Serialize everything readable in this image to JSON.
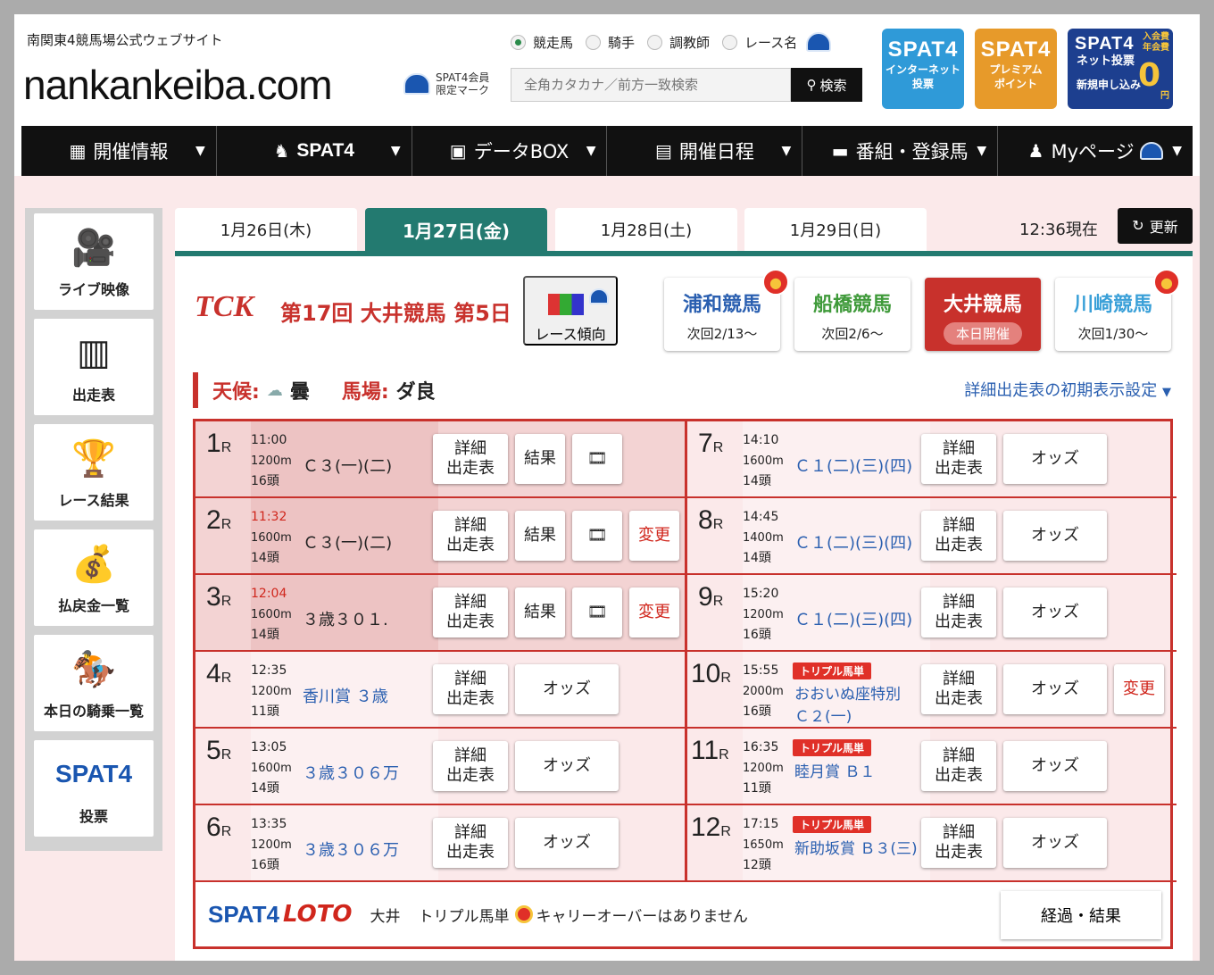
{
  "header": {
    "tagline": "南関東4競馬場公式ウェブサイト",
    "logo": "nankankeiba.com",
    "member_mark": "SPAT4会員\n限定マーク",
    "member_mark_l1": "SPAT4会員",
    "member_mark_l2": "限定マーク",
    "search_modes": [
      {
        "label": "競走馬",
        "selected": true
      },
      {
        "label": "騎手",
        "selected": false
      },
      {
        "label": "調教師",
        "selected": false
      },
      {
        "label": "レース名",
        "selected": false
      }
    ],
    "search_placeholder": "全角カタカナ／前方一致検索",
    "search_button": "検索",
    "buttons": [
      {
        "title": "SPAT4",
        "sub1": "インターネット",
        "sub2": "投票",
        "color": "#2f9ad8"
      },
      {
        "title": "SPAT4",
        "sub1": "プレミアム",
        "sub2": "ポイント",
        "color": "#e79a2a"
      },
      {
        "title": "SPAT4",
        "sub1": "ネット投票",
        "sub2": "新規申し込み",
        "tag1": "入会費",
        "tag2": "年会費",
        "zero": "0",
        "yen": "円",
        "color": "#1d3f8f"
      }
    ]
  },
  "nav": [
    {
      "label": "開催情報",
      "icon": "calendar-grid-icon"
    },
    {
      "label": "SPAT4",
      "icon": "horse-icon"
    },
    {
      "label": "データBOX",
      "icon": "chart-box-icon"
    },
    {
      "label": "開催日程",
      "icon": "calendar-icon"
    },
    {
      "label": "番組・登録馬",
      "icon": "list-icon"
    },
    {
      "label": "Myページ",
      "icon": "person-icon"
    }
  ],
  "sidebar": [
    {
      "label": "ライブ映像",
      "icon": "video-camera-icon"
    },
    {
      "label": "出走表",
      "icon": "entry-table-icon"
    },
    {
      "label": "レース結果",
      "icon": "podium-icon"
    },
    {
      "label": "払戻金一覧",
      "icon": "coins-icon"
    },
    {
      "label": "本日の騎乗一覧",
      "icon": "jockey-icon"
    },
    {
      "label": "SPAT4",
      "sub": "投票",
      "icon": "spat4-logo-icon"
    }
  ],
  "date_tabs": [
    {
      "label": "1月26日(木)",
      "active": false
    },
    {
      "label": "1月27日(金)",
      "active": true
    },
    {
      "label": "1月28日(土)",
      "active": false
    },
    {
      "label": "1月29日(日)",
      "active": false
    }
  ],
  "status": {
    "time": "12:36現在",
    "refresh": "更新"
  },
  "meeting": {
    "logo": "TCK",
    "title": "第17回 大井競馬 第5日",
    "trend": "レース傾向"
  },
  "venues": [
    {
      "name": "浦和競馬",
      "sub": "次回2/13〜",
      "color": "#2a5fb0",
      "coin": true
    },
    {
      "name": "船橋競馬",
      "sub": "次回2/6〜",
      "color": "#3f9a3a",
      "coin": false
    },
    {
      "name": "大井競馬",
      "sub": "本日開催",
      "active": true
    },
    {
      "name": "川崎競馬",
      "sub": "次回1/30〜",
      "color": "#3aa0d8",
      "coin": true
    }
  ],
  "conditions": {
    "weather_label": "天候:",
    "weather": "曇",
    "track_label": "馬場:",
    "track": "ダ良",
    "setting_link": "詳細出走表の初期表示設定"
  },
  "races": [
    {
      "no": "1",
      "time": "11:00",
      "dist": "1200m",
      "heads": "16頭",
      "name": "Ｃ３(一)(二)",
      "link": false,
      "done": true,
      "buttons": [
        "detail",
        "result",
        "video"
      ]
    },
    {
      "no": "2",
      "time": "11:32",
      "time_changed": true,
      "dist": "1600m",
      "heads": "14頭",
      "name": "Ｃ３(一)(二)",
      "link": false,
      "done": true,
      "buttons": [
        "detail",
        "result",
        "video",
        "change"
      ]
    },
    {
      "no": "3",
      "time": "12:04",
      "time_changed": true,
      "dist": "1600m",
      "heads": "14頭",
      "name": "３歳３０１.",
      "link": false,
      "done": true,
      "buttons": [
        "detail",
        "result",
        "video",
        "change"
      ]
    },
    {
      "no": "4",
      "time": "12:35",
      "dist": "1200m",
      "heads": "11頭",
      "name": "香川賞 ３歳",
      "link": true,
      "buttons": [
        "detail",
        "odds"
      ]
    },
    {
      "no": "5",
      "time": "13:05",
      "dist": "1600m",
      "heads": "14頭",
      "name": "３歳３０６万",
      "link": true,
      "buttons": [
        "detail",
        "odds"
      ]
    },
    {
      "no": "6",
      "time": "13:35",
      "dist": "1200m",
      "heads": "16頭",
      "name": "３歳３０６万",
      "link": true,
      "buttons": [
        "detail",
        "odds"
      ]
    },
    {
      "no": "7",
      "time": "14:10",
      "dist": "1600m",
      "heads": "14頭",
      "name": "Ｃ１(二)(三)(四)",
      "link": true,
      "buttons": [
        "detail",
        "odds"
      ]
    },
    {
      "no": "8",
      "time": "14:45",
      "dist": "1400m",
      "heads": "14頭",
      "name": "Ｃ１(二)(三)(四)",
      "link": true,
      "buttons": [
        "detail",
        "odds"
      ]
    },
    {
      "no": "9",
      "time": "15:20",
      "dist": "1200m",
      "heads": "16頭",
      "name": "Ｃ１(二)(三)(四)",
      "link": true,
      "buttons": [
        "detail",
        "odds"
      ]
    },
    {
      "no": "10",
      "time": "15:55",
      "dist": "2000m",
      "heads": "16頭",
      "name": "おおいぬ座特別",
      "name2": "Ｃ２(一)",
      "link": true,
      "triple": "トリプル馬単",
      "buttons": [
        "detail",
        "odds",
        "change"
      ]
    },
    {
      "no": "11",
      "time": "16:35",
      "dist": "1200m",
      "heads": "11頭",
      "name": "睦月賞 Ｂ１",
      "link": true,
      "triple": "トリプル馬単",
      "buttons": [
        "detail",
        "odds"
      ]
    },
    {
      "no": "12",
      "time": "17:15",
      "dist": "1650m",
      "heads": "12頭",
      "name": "新助坂賞 Ｂ３(三)",
      "link": true,
      "triple": "トリプル馬単",
      "buttons": [
        "detail",
        "odds"
      ]
    }
  ],
  "race_labels": {
    "r": "R",
    "detail1": "詳細",
    "detail2": "出走表",
    "result": "結果",
    "odds": "オッズ",
    "change": "変更"
  },
  "lotto": {
    "logo1": "SPAT4",
    "logo2": "LOTO",
    "venue": "大井",
    "text1": "トリプル馬単",
    "text2": "キャリーオーバーはありません",
    "button": "経過・結果"
  }
}
